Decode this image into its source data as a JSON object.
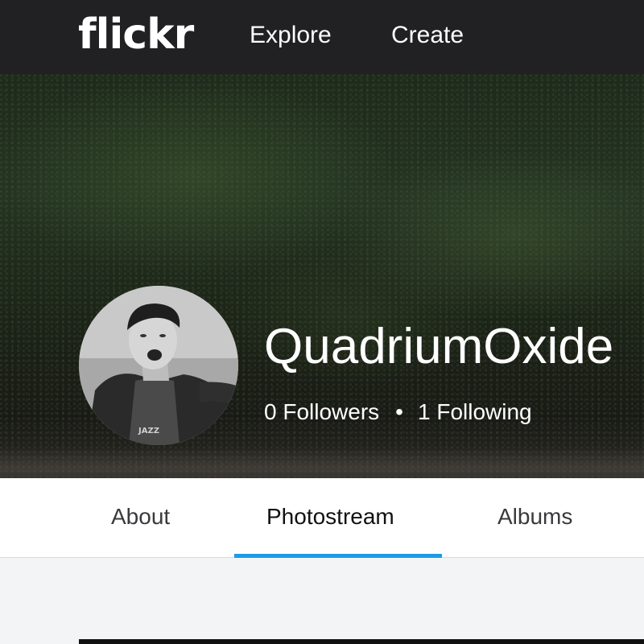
{
  "header": {
    "logo": "flickr",
    "nav": [
      {
        "label": "Explore"
      },
      {
        "label": "Create"
      }
    ]
  },
  "profile": {
    "username": "QuadriumOxide",
    "followers": "0 Followers",
    "separator": "•",
    "following": "1 Following"
  },
  "tabs": [
    {
      "label": "About"
    },
    {
      "label": "Photostream",
      "active": true
    },
    {
      "label": "Albums"
    }
  ],
  "colors": {
    "topbar": "#212124",
    "active_tab_underline": "#1c9be6",
    "page_background": "#f3f4f6"
  }
}
